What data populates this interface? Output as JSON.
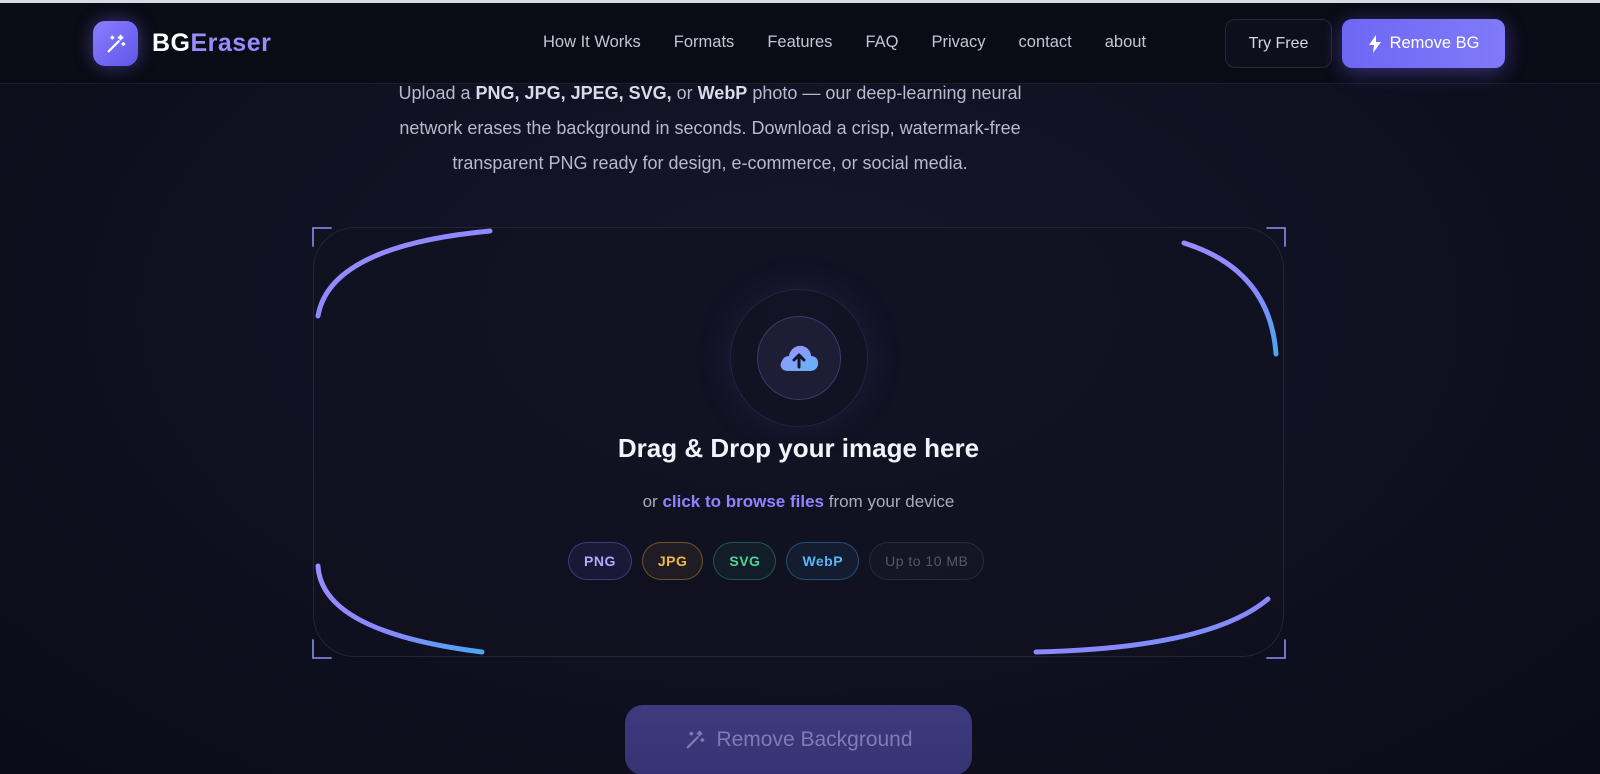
{
  "nav": {
    "logo_bg": "BG",
    "logo_eraser": "Eraser",
    "links": [
      "How It Works",
      "Formats",
      "Features",
      "FAQ",
      "Privacy",
      "contact",
      "about"
    ],
    "try_free": "Try Free",
    "remove_bg": "Remove BG"
  },
  "hero": {
    "desc_line1_a": "Upload a ",
    "desc_formats": "PNG, JPG, JPEG, SVG,",
    "desc_line1_b": " or ",
    "desc_webp": "WebP",
    "desc_line1_c": " photo — our deep-learning neural",
    "desc_line2": "network erases the background in seconds. Download a crisp, watermark-free",
    "desc_line3": "transparent PNG ready for design, e-commerce, or social media."
  },
  "dropzone": {
    "icon": "cloud-upload-icon",
    "title": "Drag & Drop your image here",
    "sub_before": "or ",
    "browse": "click to browse files",
    "sub_after": " from your device",
    "chips": [
      "PNG",
      "JPG",
      "SVG",
      "WebP",
      "Up to 10 MB"
    ]
  },
  "action": {
    "remove_background": "Remove Background"
  },
  "colors": {
    "accent": "#7a6ff8",
    "accent_blue": "#5ab4f5",
    "background": "#0f1020"
  }
}
